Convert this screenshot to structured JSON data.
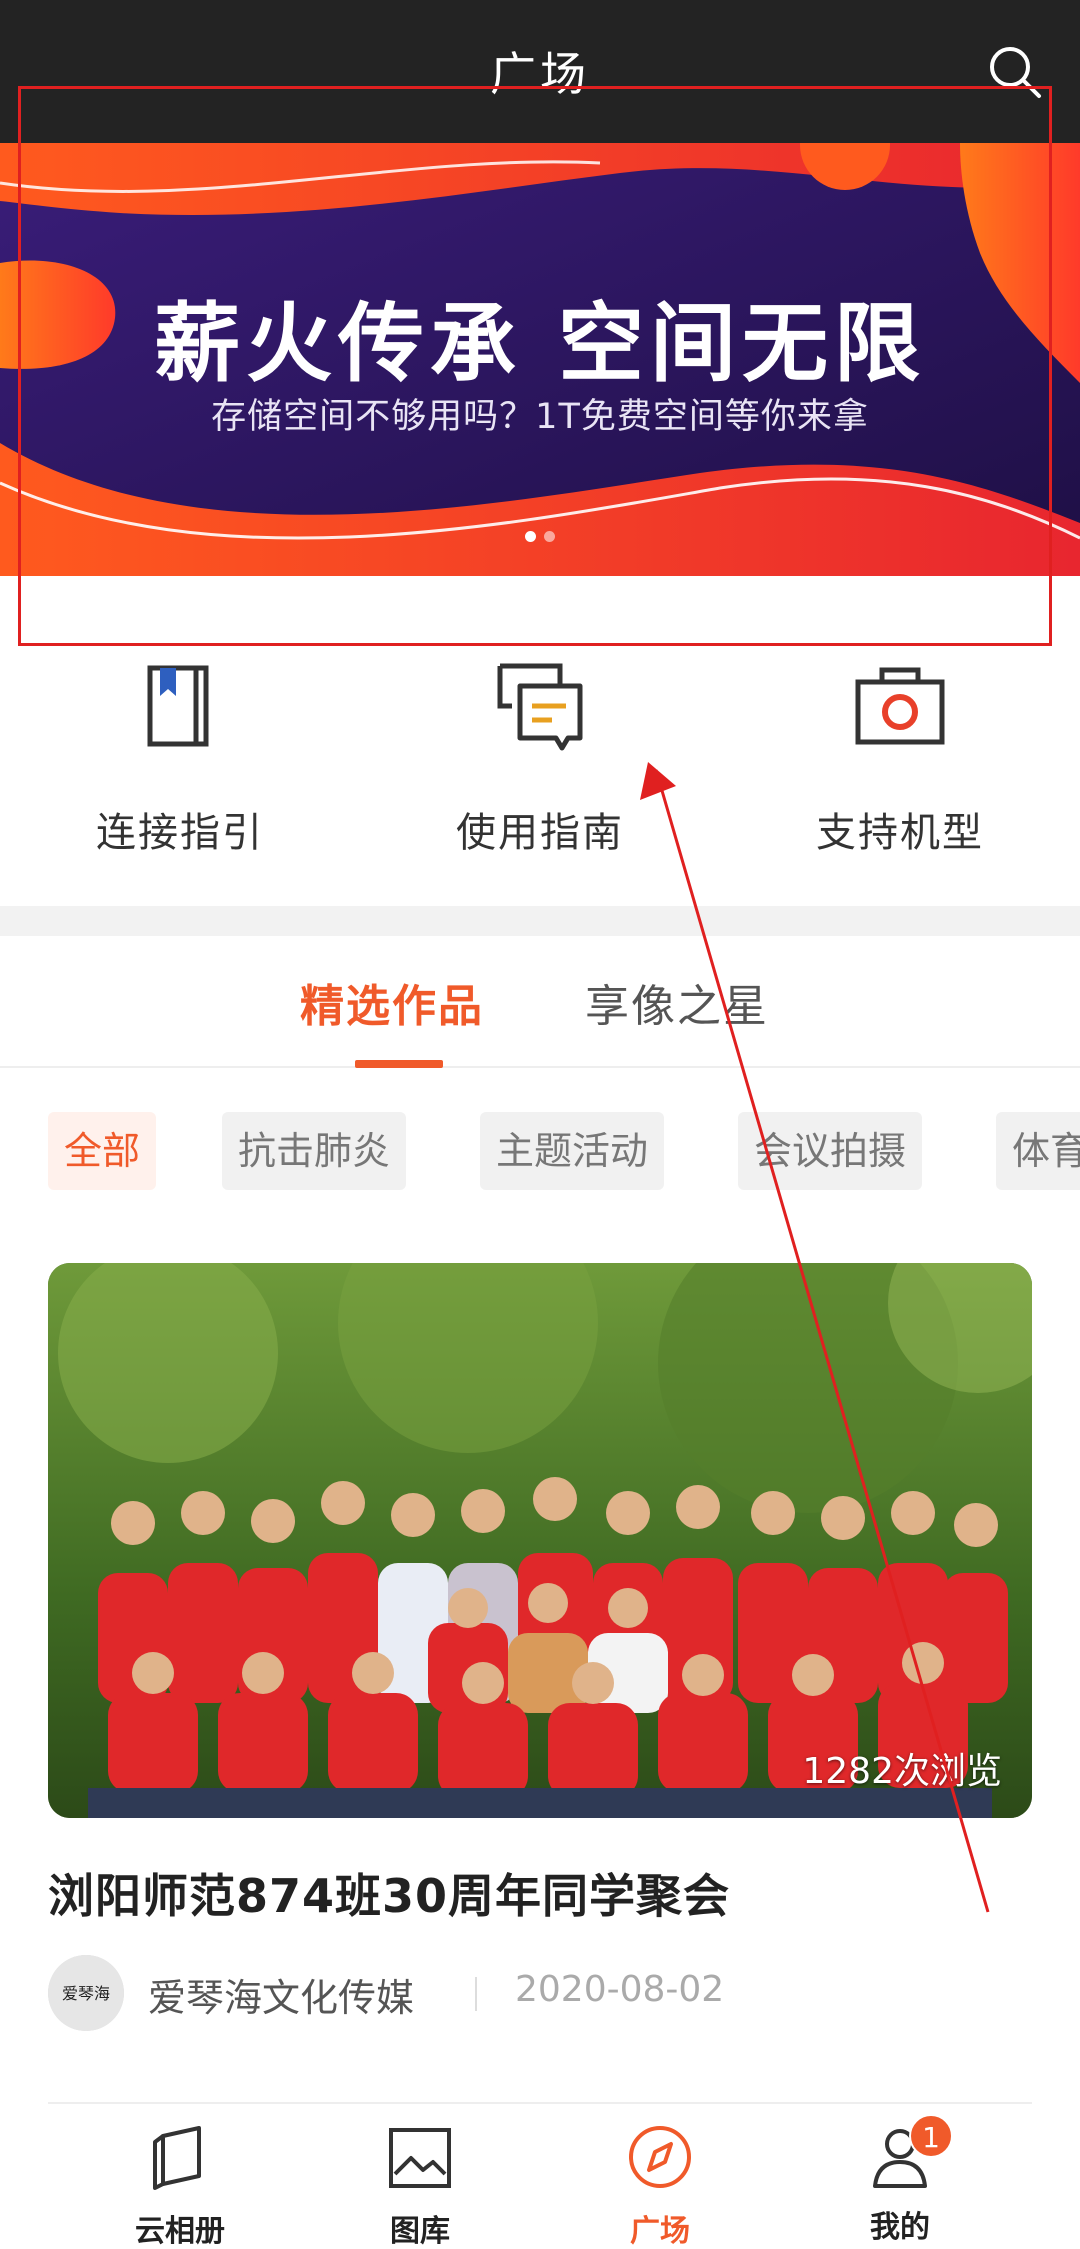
{
  "header": {
    "title": "广场",
    "search_icon": "search-icon"
  },
  "banner": {
    "title": "薪火传承  空间无限",
    "subtitle": "存储空间不够用吗？1T免费空间等你来拿",
    "slide_count": 2,
    "active_slide": 1
  },
  "quick_actions": [
    {
      "label": "连接指引",
      "icon": "bookmark-book-icon"
    },
    {
      "label": "使用指南",
      "icon": "chat-guide-icon"
    },
    {
      "label": "支持机型",
      "icon": "camera-icon"
    }
  ],
  "tabs": [
    {
      "label": "精选作品",
      "active": true
    },
    {
      "label": "享像之星",
      "active": false
    }
  ],
  "filters": [
    {
      "label": "全部",
      "active": true
    },
    {
      "label": "抗击肺炎",
      "active": false
    },
    {
      "label": "主题活动",
      "active": false
    },
    {
      "label": "会议拍摄",
      "active": false
    },
    {
      "label": "体育",
      "active": false
    }
  ],
  "card": {
    "view_count": "1282次浏览",
    "title": "浏阳师范874班30周年同学聚会",
    "author": "爱琴海文化传媒",
    "date": "2020-08-02",
    "avatar_text": "爱琴海"
  },
  "bottom_nav": [
    {
      "label": "云相册",
      "icon": "album-icon",
      "active": false
    },
    {
      "label": "图库",
      "icon": "gallery-icon",
      "active": false
    },
    {
      "label": "广场",
      "icon": "compass-icon",
      "active": true
    },
    {
      "label": "我的",
      "icon": "user-icon",
      "active": false,
      "badge": "1"
    }
  ],
  "colors": {
    "accent": "#f05a2a",
    "header_bg": "#232323",
    "banner_bg": "#2a1352",
    "annotation": "#e02020"
  }
}
